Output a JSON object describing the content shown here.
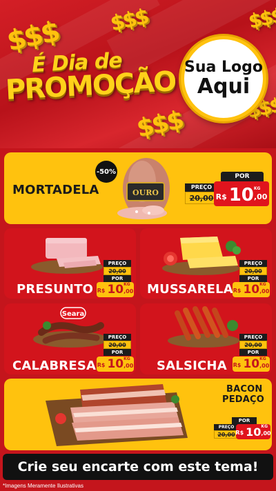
{
  "header": {
    "title_line1": "É Dia de",
    "title_line2": "PROMOÇÃO",
    "dollar_symbol": "$$$",
    "logo_line1": "Sua Logo",
    "logo_line2": "Aqui"
  },
  "colors": {
    "brand_red": "#d2141c",
    "brand_yellow": "#ffc20e",
    "dark": "#1c1c1c"
  },
  "labels": {
    "preco": "PREÇO",
    "por": "POR",
    "currency": "R$",
    "unit": "KG"
  },
  "products": {
    "mortadela": {
      "name": "MORTADELA",
      "badge": "-50%",
      "brand": "OURO",
      "old_price": "20,00",
      "new_int": "10",
      "new_dec": ",00"
    },
    "presunto": {
      "name": "PRESUNTO",
      "old_price": "20,00",
      "new_int": "10",
      "new_dec": ",00"
    },
    "mussarela": {
      "name": "MUSSARELA",
      "old_price": "20,00",
      "new_int": "10",
      "new_dec": ",00"
    },
    "calabresa": {
      "name": "CALABRESA",
      "brand": "Seara",
      "old_price": "20,00",
      "new_int": "10",
      "new_dec": ",00"
    },
    "salsicha": {
      "name": "SALSICHA",
      "old_price": "20,00",
      "new_int": "10",
      "new_dec": ",00"
    },
    "bacon": {
      "name_line1": "BACON",
      "name_line2": "PEDAÇO",
      "old_price": "20,00",
      "new_int": "10",
      "new_dec": ",00"
    }
  },
  "footer": {
    "cta": "Crie seu encarte com este tema!",
    "disclaimer": "*Imagens Meramente Ilustrativas"
  }
}
